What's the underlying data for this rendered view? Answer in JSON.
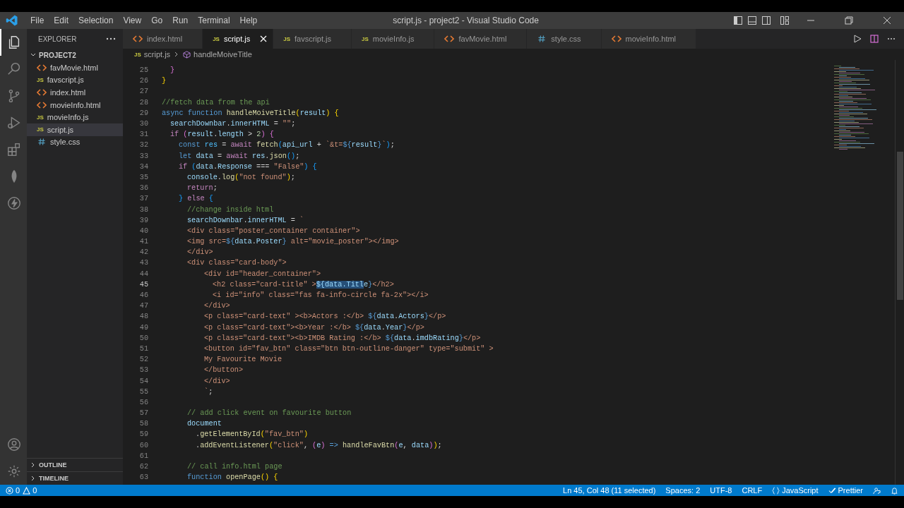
{
  "window": {
    "title": "script.js - project2 - Visual Studio Code"
  },
  "menu": [
    "File",
    "Edit",
    "Selection",
    "View",
    "Go",
    "Run",
    "Terminal",
    "Help"
  ],
  "activity_bar": [
    {
      "kind": "files",
      "selected": true
    },
    {
      "kind": "search",
      "selected": false
    },
    {
      "kind": "source-control",
      "selected": false
    },
    {
      "kind": "run-debug",
      "selected": false
    },
    {
      "kind": "extensions",
      "selected": false
    },
    {
      "kind": "leaf",
      "selected": false
    },
    {
      "kind": "lightning",
      "selected": false
    }
  ],
  "sidebar": {
    "title": "EXPLORER",
    "folder": "PROJECT2",
    "items": [
      {
        "name": "favMovie.html",
        "kind": "html",
        "selected": false
      },
      {
        "name": "favscript.js",
        "kind": "js",
        "icon": "JS",
        "selected": false
      },
      {
        "name": "index.html",
        "kind": "html",
        "selected": false
      },
      {
        "name": "movieInfo.html",
        "kind": "html",
        "selected": false
      },
      {
        "name": "movieInfo.js",
        "kind": "js",
        "icon": "JS",
        "selected": false
      },
      {
        "name": "script.js",
        "kind": "js",
        "icon": "JS",
        "selected": true
      },
      {
        "name": "style.css",
        "kind": "css",
        "selected": false
      }
    ],
    "sections": [
      "OUTLINE",
      "TIMELINE"
    ]
  },
  "tabs": [
    {
      "label": "index.html",
      "kind": "html",
      "selected": false
    },
    {
      "label": "script.js",
      "kind": "js",
      "icon": "JS",
      "selected": true
    },
    {
      "label": "favscript.js",
      "kind": "js",
      "icon": "JS",
      "selected": false
    },
    {
      "label": "movieInfo.js",
      "kind": "js",
      "icon": "JS",
      "selected": false
    },
    {
      "label": "favMovie.html",
      "kind": "html",
      "selected": false
    },
    {
      "label": "style.css",
      "kind": "css",
      "selected": false
    },
    {
      "label": "movieInfo.html",
      "kind": "html",
      "selected": false
    }
  ],
  "breadcrumb": {
    "file": "script.js",
    "icon": "JS",
    "symbol": "handleMoiveTitle"
  },
  "editor": {
    "lines": [
      {
        "number": "25",
        "active": false,
        "tokens": [
          {
            "text": "  }",
            "kind": "br2"
          }
        ]
      },
      {
        "number": "26",
        "active": false,
        "tokens": [
          {
            "text": "}",
            "kind": "br1"
          }
        ]
      },
      {
        "number": "27",
        "active": false
      },
      {
        "number": "28",
        "active": false,
        "tokens": [
          {
            "text": "//fetch data from the api",
            "kind": "com"
          }
        ]
      },
      {
        "number": "29",
        "active": false,
        "tokens": [
          {
            "text": "async ",
            "kind": "kw"
          },
          {
            "text": "function ",
            "kind": "kw"
          },
          {
            "text": "handleMoiveTitle",
            "kind": "fn"
          },
          {
            "text": "(",
            "kind": "br1"
          },
          {
            "text": "result",
            "kind": "var"
          },
          {
            "text": ") ",
            "kind": "br1"
          },
          {
            "text": "{",
            "kind": "br1"
          }
        ]
      },
      {
        "number": "30",
        "active": false,
        "tokens": [
          {
            "text": "  searchDownbar",
            "kind": "var"
          },
          {
            "text": ".",
            "kind": "p"
          },
          {
            "text": "innerHTML",
            "kind": "var"
          },
          {
            "text": " = ",
            "kind": "p"
          },
          {
            "text": "\"\"",
            "kind": "str"
          },
          {
            "text": ";",
            "kind": "p"
          }
        ]
      },
      {
        "number": "31",
        "active": false,
        "tokens": [
          {
            "text": "  if ",
            "kind": "ctl"
          },
          {
            "text": "(",
            "kind": "br2"
          },
          {
            "text": "result",
            "kind": "var"
          },
          {
            "text": ".",
            "kind": "p"
          },
          {
            "text": "length",
            "kind": "var"
          },
          {
            "text": " > ",
            "kind": "p"
          },
          {
            "text": "2",
            "kind": "num"
          },
          {
            "text": ") ",
            "kind": "br2"
          },
          {
            "text": "{",
            "kind": "br2"
          }
        ]
      },
      {
        "number": "32",
        "active": false,
        "tokens": [
          {
            "text": "    const ",
            "kind": "kw"
          },
          {
            "text": "res",
            "kind": "const"
          },
          {
            "text": " = ",
            "kind": "p"
          },
          {
            "text": "await ",
            "kind": "ctl"
          },
          {
            "text": "fetch",
            "kind": "fn"
          },
          {
            "text": "(",
            "kind": "br3"
          },
          {
            "text": "api_url",
            "kind": "var"
          },
          {
            "text": " + ",
            "kind": "p"
          },
          {
            "text": "`&t=",
            "kind": "str"
          },
          {
            "text": "${",
            "kind": "tmpl"
          },
          {
            "text": "result",
            "kind": "var"
          },
          {
            "text": "}",
            "kind": "tmpl"
          },
          {
            "text": "`",
            "kind": "str"
          },
          {
            "text": ")",
            "kind": "br3"
          },
          {
            "text": ";",
            "kind": "p"
          }
        ]
      },
      {
        "number": "33",
        "active": false,
        "tokens": [
          {
            "text": "    let ",
            "kind": "kw"
          },
          {
            "text": "data",
            "kind": "var"
          },
          {
            "text": " = ",
            "kind": "p"
          },
          {
            "text": "await ",
            "kind": "ctl"
          },
          {
            "text": "res",
            "kind": "var"
          },
          {
            "text": ".",
            "kind": "p"
          },
          {
            "text": "json",
            "kind": "fn"
          },
          {
            "text": "()",
            "kind": "br3"
          },
          {
            "text": ";",
            "kind": "p"
          }
        ]
      },
      {
        "number": "34",
        "active": false,
        "tokens": [
          {
            "text": "    if ",
            "kind": "ctl"
          },
          {
            "text": "(",
            "kind": "br3"
          },
          {
            "text": "data",
            "kind": "var"
          },
          {
            "text": ".",
            "kind": "p"
          },
          {
            "text": "Response",
            "kind": "var"
          },
          {
            "text": " === ",
            "kind": "p"
          },
          {
            "text": "\"False\"",
            "kind": "str"
          },
          {
            "text": ") ",
            "kind": "br3"
          },
          {
            "text": "{",
            "kind": "br3"
          }
        ]
      },
      {
        "number": "35",
        "active": false,
        "tokens": [
          {
            "text": "      console",
            "kind": "var"
          },
          {
            "text": ".",
            "kind": "p"
          },
          {
            "text": "log",
            "kind": "fn"
          },
          {
            "text": "(",
            "kind": "br1"
          },
          {
            "text": "\"not found\"",
            "kind": "str"
          },
          {
            "text": ")",
            "kind": "br1"
          },
          {
            "text": ";",
            "kind": "p"
          }
        ]
      },
      {
        "number": "36",
        "active": false,
        "tokens": [
          {
            "text": "      return",
            "kind": "ctl"
          },
          {
            "text": ";",
            "kind": "p"
          }
        ]
      },
      {
        "number": "37",
        "active": false,
        "tokens": [
          {
            "text": "    } ",
            "kind": "br3"
          },
          {
            "text": "else ",
            "kind": "ctl"
          },
          {
            "text": "{",
            "kind": "br3"
          }
        ]
      },
      {
        "number": "38",
        "active": false,
        "tokens": [
          {
            "text": "      //change inside html",
            "kind": "com"
          }
        ]
      },
      {
        "number": "39",
        "active": false,
        "tokens": [
          {
            "text": "      searchDownbar",
            "kind": "var"
          },
          {
            "text": ".",
            "kind": "p"
          },
          {
            "text": "innerHTML",
            "kind": "var"
          },
          {
            "text": " = ",
            "kind": "p"
          },
          {
            "text": "`",
            "kind": "str"
          }
        ]
      },
      {
        "number": "40",
        "active": false,
        "tokens": [
          {
            "text": "      <div class=\"poster_container container\">",
            "kind": "str"
          }
        ]
      },
      {
        "number": "41",
        "active": false,
        "tokens": [
          {
            "text": "      <img src=",
            "kind": "str"
          },
          {
            "text": "${",
            "kind": "tmpl"
          },
          {
            "text": "data",
            "kind": "var"
          },
          {
            "text": ".",
            "kind": "p"
          },
          {
            "text": "Poster",
            "kind": "var"
          },
          {
            "text": "}",
            "kind": "tmpl"
          },
          {
            "text": " alt=\"movie_poster\"></img>",
            "kind": "str"
          }
        ]
      },
      {
        "number": "42",
        "active": false,
        "tokens": [
          {
            "text": "      </div>",
            "kind": "str"
          }
        ]
      },
      {
        "number": "43",
        "active": false,
        "tokens": [
          {
            "text": "      <div class=\"card-body\">",
            "kind": "str"
          }
        ]
      },
      {
        "number": "44",
        "active": false,
        "tokens": [
          {
            "text": "          <div id=\"header_container\">",
            "kind": "str"
          }
        ]
      },
      {
        "number": "45",
        "active": true,
        "tokens": [
          {
            "text": "            <h2 class=\"card-title\" >",
            "kind": "str"
          },
          {
            "text": "${data.Titl",
            "kind": "sel"
          },
          {
            "text": "e",
            "kind": "var"
          },
          {
            "text": "}",
            "kind": "tmpl"
          },
          {
            "text": "</h2>",
            "kind": "str"
          }
        ]
      },
      {
        "number": "46",
        "active": false,
        "tokens": [
          {
            "text": "            <i id=\"info\" class=\"fas fa-info-circle fa-2x\"></i>",
            "kind": "str"
          }
        ]
      },
      {
        "number": "47",
        "active": false,
        "tokens": [
          {
            "text": "          </div>",
            "kind": "str"
          }
        ]
      },
      {
        "number": "48",
        "active": false,
        "tokens": [
          {
            "text": "          <p class=\"card-text\" ><b>Actors :</b> ",
            "kind": "str"
          },
          {
            "text": "${",
            "kind": "tmpl"
          },
          {
            "text": "data",
            "kind": "var"
          },
          {
            "text": ".",
            "kind": "p"
          },
          {
            "text": "Actors",
            "kind": "var"
          },
          {
            "text": "}",
            "kind": "tmpl"
          },
          {
            "text": "</p>",
            "kind": "str"
          }
        ]
      },
      {
        "number": "49",
        "active": false,
        "tokens": [
          {
            "text": "          <p class=\"card-text\"><b>Year :</b> ",
            "kind": "str"
          },
          {
            "text": "${",
            "kind": "tmpl"
          },
          {
            "text": "data",
            "kind": "var"
          },
          {
            "text": ".",
            "kind": "p"
          },
          {
            "text": "Year",
            "kind": "var"
          },
          {
            "text": "}",
            "kind": "tmpl"
          },
          {
            "text": "</p>",
            "kind": "str"
          }
        ]
      },
      {
        "number": "50",
        "active": false,
        "tokens": [
          {
            "text": "          <p class=\"card-text\"><b>IMDB Rating :</b> ",
            "kind": "str"
          },
          {
            "text": "${",
            "kind": "tmpl"
          },
          {
            "text": "data",
            "kind": "var"
          },
          {
            "text": ".",
            "kind": "p"
          },
          {
            "text": "imdbRating",
            "kind": "var"
          },
          {
            "text": "}",
            "kind": "tmpl"
          },
          {
            "text": "</p>",
            "kind": "str"
          }
        ]
      },
      {
        "number": "51",
        "active": false,
        "tokens": [
          {
            "text": "          <button id=\"fav_btn\" class=\"btn btn-outline-danger\" type=\"submit\" >",
            "kind": "str"
          }
        ]
      },
      {
        "number": "52",
        "active": false,
        "tokens": [
          {
            "text": "          My Favourite Movie",
            "kind": "str"
          }
        ]
      },
      {
        "number": "53",
        "active": false,
        "tokens": [
          {
            "text": "          </button>",
            "kind": "str"
          }
        ]
      },
      {
        "number": "54",
        "active": false,
        "tokens": [
          {
            "text": "          </div>",
            "kind": "str"
          }
        ]
      },
      {
        "number": "55",
        "active": false,
        "tokens": [
          {
            "text": "          `",
            "kind": "str"
          },
          {
            "text": ";",
            "kind": "p"
          }
        ]
      },
      {
        "number": "56",
        "active": false
      },
      {
        "number": "57",
        "active": false,
        "tokens": [
          {
            "text": "      // add click event on favourite button",
            "kind": "com"
          }
        ]
      },
      {
        "number": "58",
        "active": false,
        "tokens": [
          {
            "text": "      document",
            "kind": "var"
          }
        ]
      },
      {
        "number": "59",
        "active": false,
        "tokens": [
          {
            "text": "        .",
            "kind": "p"
          },
          {
            "text": "getElementById",
            "kind": "fn"
          },
          {
            "text": "(",
            "kind": "br1"
          },
          {
            "text": "\"fav_btn\"",
            "kind": "str"
          },
          {
            "text": ")",
            "kind": "br1"
          }
        ]
      },
      {
        "number": "60",
        "active": false,
        "tokens": [
          {
            "text": "        .",
            "kind": "p"
          },
          {
            "text": "addEventListener",
            "kind": "fn"
          },
          {
            "text": "(",
            "kind": "br1"
          },
          {
            "text": "\"click\"",
            "kind": "str"
          },
          {
            "text": ", ",
            "kind": "p"
          },
          {
            "text": "(",
            "kind": "br2"
          },
          {
            "text": "e",
            "kind": "var"
          },
          {
            "text": ") ",
            "kind": "br2"
          },
          {
            "text": "=> ",
            "kind": "kw"
          },
          {
            "text": "handleFavBtn",
            "kind": "fn"
          },
          {
            "text": "(",
            "kind": "br2"
          },
          {
            "text": "e",
            "kind": "var"
          },
          {
            "text": ", ",
            "kind": "p"
          },
          {
            "text": "data",
            "kind": "var"
          },
          {
            "text": ")",
            "kind": "br2"
          },
          {
            "text": ")",
            "kind": "br1"
          },
          {
            "text": ";",
            "kind": "p"
          }
        ]
      },
      {
        "number": "61",
        "active": false
      },
      {
        "number": "62",
        "active": false,
        "tokens": [
          {
            "text": "      // call info.html page",
            "kind": "com"
          }
        ]
      },
      {
        "number": "63",
        "active": false,
        "tokens": [
          {
            "text": "      function ",
            "kind": "kw"
          },
          {
            "text": "openPage",
            "kind": "fn"
          },
          {
            "text": "() ",
            "kind": "br1"
          },
          {
            "text": "{",
            "kind": "br1"
          }
        ]
      }
    ]
  },
  "status_bar": {
    "left": [
      {
        "kind": "errors",
        "text": "0"
      },
      {
        "kind": "warnings",
        "text": "0"
      }
    ],
    "right": [
      {
        "kind": "text",
        "text": "Ln 45, Col 48 (11 selected)"
      },
      {
        "kind": "text",
        "text": "Spaces: 2"
      },
      {
        "kind": "text",
        "text": "UTF-8"
      },
      {
        "kind": "text",
        "text": "CRLF"
      },
      {
        "kind": "language",
        "text": "JavaScript"
      },
      {
        "kind": "formatter",
        "text": "Prettier"
      },
      {
        "kind": "feedback"
      },
      {
        "kind": "bell"
      }
    ]
  }
}
